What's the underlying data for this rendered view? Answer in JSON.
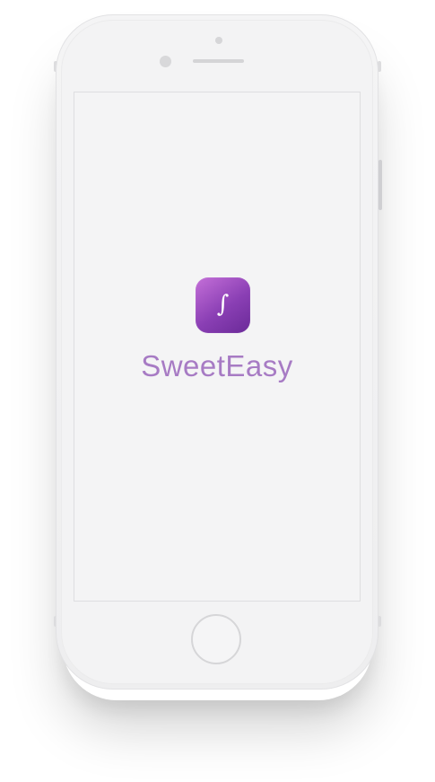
{
  "app": {
    "name": "SweetEasy",
    "icon_glyph": "∫",
    "icon_name": "sweeteasy-logo-icon",
    "brand_gradient_start": "#c46fd8",
    "brand_gradient_end": "#6a2a98",
    "name_color": "#a77bc4"
  },
  "device": {
    "type": "phone",
    "body_color": "#f3f3f4",
    "screen_color": "#f4f4f5"
  }
}
